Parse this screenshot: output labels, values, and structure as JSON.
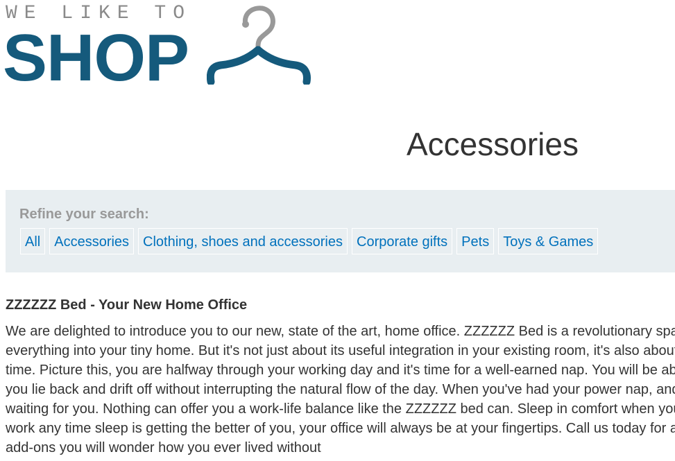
{
  "logo": {
    "tagline": "WE LIKE TO",
    "brand": "SHOP",
    "icon": "hanger-icon",
    "colors": {
      "brand": "#155a7c",
      "tagline": "#8a8a8a",
      "hook": "#999999"
    }
  },
  "page": {
    "title": "Accessories"
  },
  "filters": {
    "label": "Refine your search:",
    "items": [
      {
        "label": "All"
      },
      {
        "label": "Accessories"
      },
      {
        "label": "Clothing, shoes and accessories"
      },
      {
        "label": "Corporate gifts"
      },
      {
        "label": "Pets"
      },
      {
        "label": "Toys & Games"
      }
    ]
  },
  "product": {
    "title": "ZZZZZZ Bed - Your New Home Office",
    "description_lines": [
      "We are delighted to introduce you to our new, state of the art, home office. ZZZZZZ Bed is a revolutionary spa",
      "everything into your tiny home. But it's not just about its useful integration in your existing room, it's also about",
      "time. Picture this, you are halfway through your working day and it's time for a well-earned nap. You will be ab",
      "you lie back and drift off without interrupting the natural flow of the day. When you've had your power nap, and",
      "waiting for you. Nothing can offer you a work-life balance like the ZZZZZZ bed can. Sleep in comfort when you",
      "work any time sleep is getting the better of you, your office will always be at your fingertips. Call us today for a",
      "add-ons you will wonder how you ever lived without"
    ]
  },
  "colors": {
    "link": "#0071bc",
    "panel_bg": "#e8eef1",
    "text": "#333333"
  }
}
